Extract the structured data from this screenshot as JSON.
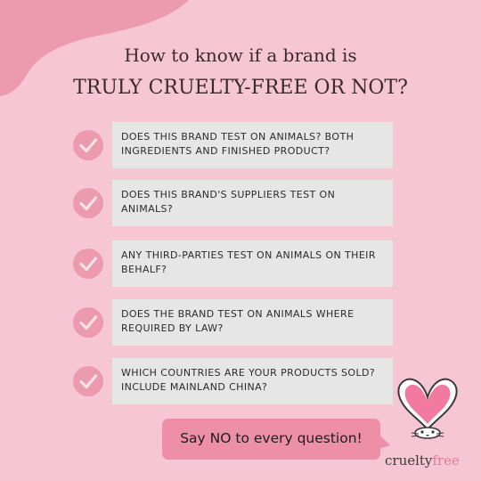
{
  "title": {
    "line1": "How to know if a brand is",
    "line2": "TRULY CRUELTY-FREE OR NOT?"
  },
  "questions": [
    "DOES THIS BRAND TEST ON ANIMALS? BOTH INGREDIENTS AND FINISHED PRODUCT?",
    "DOES THIS BRAND'S SUPPLIERS TEST ON ANIMALS?",
    "ANY THIRD-PARTIES TEST ON ANIMALS ON THEIR BEHALF?",
    "DOES THE BRAND TEST ON ANIMALS WHERE REQUIRED BY LAW?",
    "WHICH COUNTRIES ARE YOUR PRODUCTS SOLD? INCLUDE MAINLAND CHINA?"
  ],
  "callout": "Say NO to every question!",
  "logo": {
    "word1": "cruelty",
    "word2": "free"
  },
  "icons": {
    "bullet": "checkmark-circle-icon",
    "logo": "bunny-icon"
  },
  "colors": {
    "background": "#f7c6d4",
    "blob": "#ec9aae",
    "accent": "#ec8fa7",
    "question_box": "#e6e6e6"
  }
}
